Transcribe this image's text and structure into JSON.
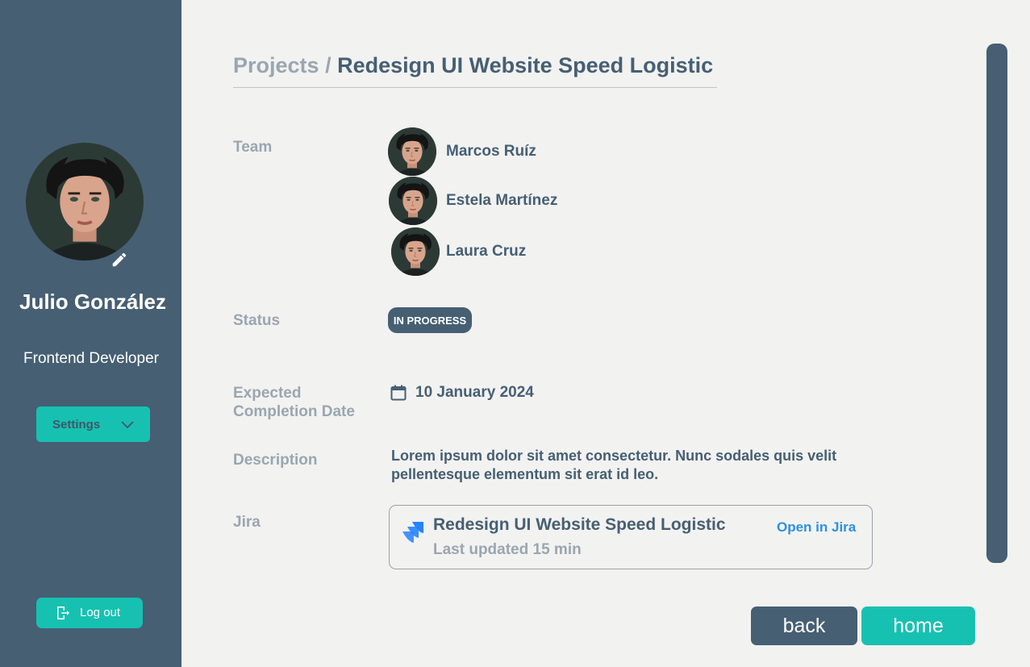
{
  "profile": {
    "name": "Julio González",
    "role": "Frontend Developer",
    "avatar_icon": "user-photo",
    "edit_icon": "pencil-icon"
  },
  "sidebar": {
    "settings_label": "Settings",
    "logout_label": "Log out"
  },
  "breadcrumb": {
    "root": "Projects",
    "separator": " / ",
    "current": "Redesign UI Website Speed Logistic"
  },
  "fields": {
    "team_label": "Team",
    "status_label": "Status",
    "date_label": "Expected Completion Date",
    "description_label": "Description",
    "jira_label": "Jira"
  },
  "team": [
    {
      "name": "Marcos Ruíz"
    },
    {
      "name": "Estela Martínez"
    },
    {
      "name": "Laura Cruz"
    }
  ],
  "status": "IN PROGRESS",
  "completion_date": "10 January 2024",
  "description": "Lorem ipsum dolor sit amet consectetur. Nunc sodales quis velit pellentesque elementum sit erat id leo.",
  "jira": {
    "title": "Redesign UI Website Speed Logistic",
    "updated": "Last updated 15 min",
    "link": "Open in Jira"
  },
  "actions": {
    "back": "back",
    "home": "home"
  },
  "colors": {
    "sidebar": "#465f73",
    "accent": "#17c1b1",
    "background": "#f2f2f1",
    "muted_text": "#9aa6b0",
    "link": "#2b91e0"
  }
}
